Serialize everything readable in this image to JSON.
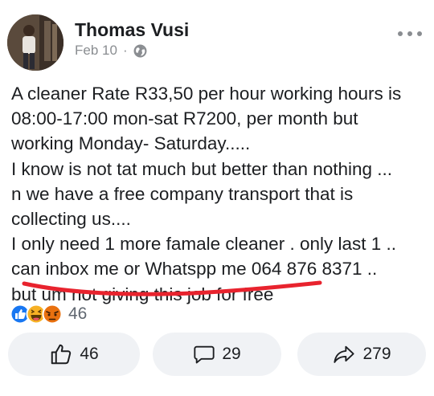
{
  "post": {
    "author": "Thomas Vusi",
    "date": "Feb 10",
    "separator": "·",
    "audience_icon": "globe-icon",
    "more_icon": "more-options-icon",
    "lines": [
      "A cleaner Rate R33,50 per hour working hours is",
      "08:00-17:00  mon-sat R7200, per month but",
      "working Monday- Saturday.....",
      "I know is not tat much but better than nothing ...",
      "n we have a free company transport that is",
      "collecting us....",
      "I only need 1 more famale cleaner . only last 1 ..",
      "can inbox me or Whatspp me 064 876 8371 ..",
      "but um not giving this job for free"
    ],
    "annotation_color": "#e8232e"
  },
  "reactions": {
    "icons": [
      "like-reaction-icon",
      "haha-reaction-icon",
      "angry-reaction-icon"
    ],
    "count": "46"
  },
  "actions": {
    "like": {
      "icon": "thumbs-up-icon",
      "count": "46"
    },
    "comment": {
      "icon": "comment-icon",
      "count": "29"
    },
    "share": {
      "icon": "share-icon",
      "count": "279"
    }
  },
  "colors": {
    "like_blue": "#1877f2",
    "haha_yellow": "#f7b125",
    "angry_orange": "#e9710f",
    "button_bg": "#f0f2f5",
    "meta_gray": "#8a8d91"
  }
}
